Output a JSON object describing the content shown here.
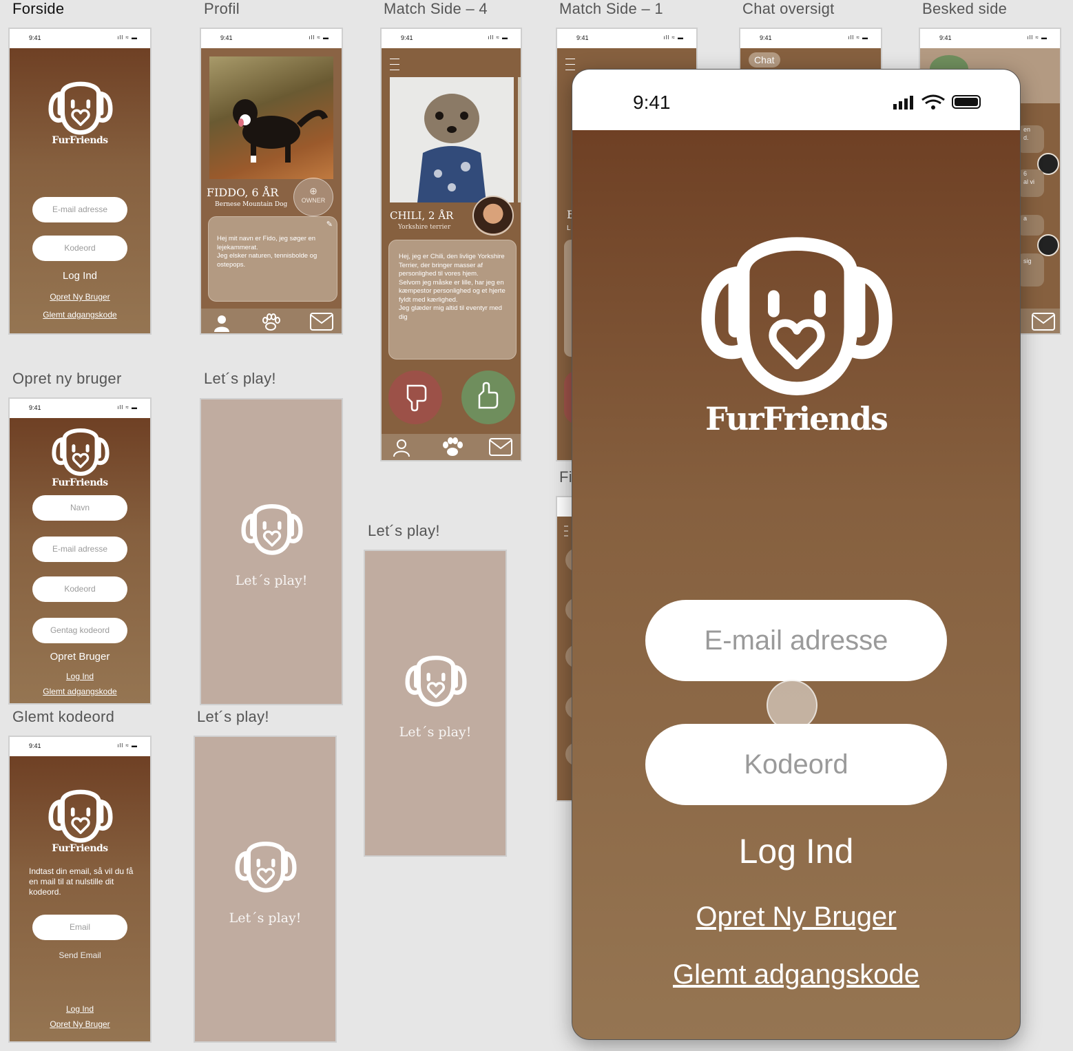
{
  "labels": {
    "forside": "Forside",
    "profil": "Profil",
    "match4": "Match Side – 4",
    "match1": "Match Side – 1",
    "chat_oversigt": "Chat oversigt",
    "besked_side": "Besked side",
    "opret_ny_bruger": "Opret ny bruger",
    "letsplay_a": "Let´s play!",
    "letsplay_b": "Let´s play!",
    "letsplay_c": "Let´s play!",
    "glemt_kodeord": "Glemt kodeord"
  },
  "status": {
    "time": "9:41",
    "icons": "ıll ≈ ▬"
  },
  "brand": "FurFriends",
  "forside": {
    "email_placeholder": "E-mail adresse",
    "password_placeholder": "Kodeord",
    "login": "Log Ind",
    "create": "Opret Ny Bruger",
    "forgot": "Glemt adgangskode"
  },
  "profil": {
    "name": "FIDDO, 6 ÅR",
    "breed": "Bernese Mountain Dog",
    "owner": "OWNER",
    "bio": "Hej mit navn er Fido, jeg søger en lejekammerat.\nJeg elsker naturen, tennisbolde og ostepops."
  },
  "match4": {
    "name": "CHILI, 2 ÅR",
    "breed": "Yorkshire terrier",
    "bio": "Hej, jeg er Chili, den livlige Yorkshire Terrier, der bringer masser af personlighed til vores hjem.\nSelvom jeg måske er lille, har jeg en kæmpestor personlighed og et hjerte fyldt med kærlighed.\nJeg glæder mig altid til eventyr med dig"
  },
  "match1": {
    "peek_name": "E",
    "peek_sub": "L",
    "below_label": "Fi"
  },
  "chat": {
    "chip": "Chat"
  },
  "besked": {
    "b1": "en\nd.",
    "b2": "6\nal vi",
    "b3": "a",
    "b4": "sig"
  },
  "opret": {
    "name": "Navn",
    "email": "E-mail adresse",
    "password": "Kodeord",
    "repeat": "Gentag kodeord",
    "create": "Opret Bruger",
    "login": "Log Ind",
    "forgot": "Glemt adgangskode"
  },
  "letsplay_text": "Let´s play!",
  "glemt": {
    "info": "Indtast din email, så vil du få en mail til at nulstille dit kodeord.",
    "email": "Email",
    "send": "Send Email",
    "login": "Log Ind",
    "create": "Opret Ny Bruger"
  },
  "big": {
    "time": "9:41",
    "email_placeholder": "E-mail adresse",
    "password_placeholder": "Kodeord",
    "login": "Log Ind",
    "create": "Opret Ny Bruger",
    "forgot": "Glemt adgangskode"
  },
  "colors": {
    "brown_top": "#6b3b20",
    "brown_bottom": "#957552",
    "tan": "#c0aca0",
    "dislike": "#9c5148",
    "like": "#6f8e5d"
  }
}
